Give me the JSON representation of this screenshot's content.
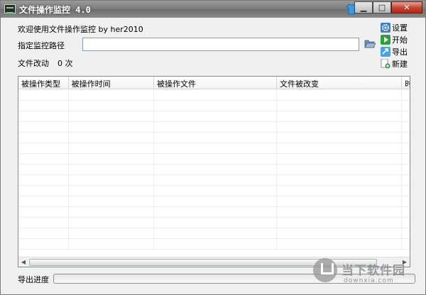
{
  "window": {
    "title": "文件操作监控 4.0",
    "minimize_glyph": "▁",
    "maximize_glyph": "□",
    "close_glyph": "✕"
  },
  "header": {
    "welcome": "欢迎使用文件操作监控 by her2010",
    "path_label": "指定监控路径",
    "path_value": "",
    "changes_label": "文件改动",
    "changes_count": "0 次"
  },
  "actions": [
    {
      "label": "设置",
      "icon": "gear-icon"
    },
    {
      "label": "开始",
      "icon": "play-icon"
    },
    {
      "label": "导出",
      "icon": "export-icon"
    },
    {
      "label": "新建",
      "icon": "new-icon"
    }
  ],
  "table": {
    "columns": [
      "被操作类型",
      "被操作时间",
      "被操作文件",
      "文件被改变",
      "时"
    ],
    "rows": []
  },
  "progress": {
    "label": "导出进度",
    "value_fraction": 0
  },
  "watermark": {
    "title": "当下软件园",
    "url": "downxia.com"
  },
  "colors": {
    "accent_green": "#3fbf3f",
    "close_red": "#c7402c",
    "titlebar": "#7c7c7c"
  }
}
